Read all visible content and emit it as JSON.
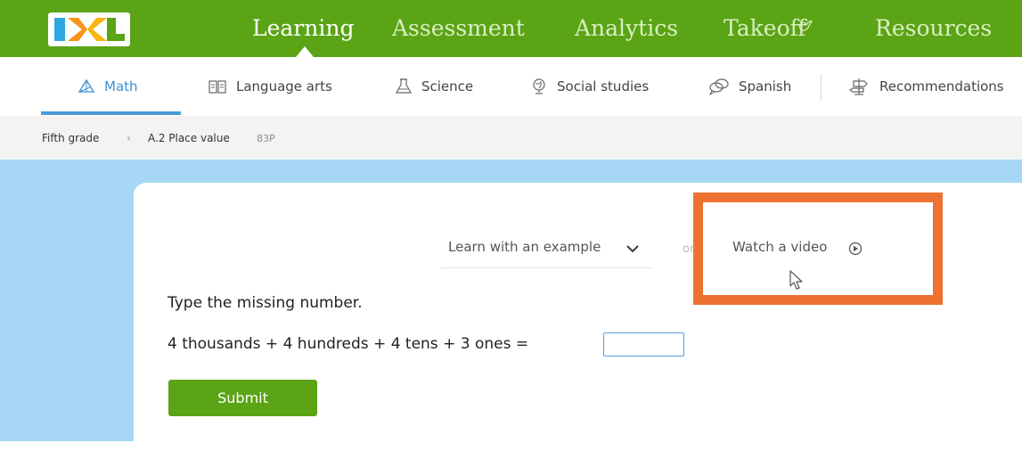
{
  "brand": {
    "logo_text": "IXL",
    "colors": {
      "brand_green": "#5aa415",
      "link_blue": "#3d8fd1",
      "practice_blue": "#a6d8f5",
      "highlight_orange": "#ed7130"
    }
  },
  "topnav": {
    "items": [
      {
        "label": "Learning",
        "active": true
      },
      {
        "label": "Assessment",
        "active": false
      },
      {
        "label": "Analytics",
        "active": false
      },
      {
        "label": "Takeoff",
        "active": false,
        "icon": "bird-icon"
      },
      {
        "label": "Resources",
        "active": false
      }
    ]
  },
  "subjects": {
    "tabs": [
      {
        "label": "Math",
        "icon": "geometry-icon",
        "active": true
      },
      {
        "label": "Language arts",
        "icon": "book-icon",
        "active": false
      },
      {
        "label": "Science",
        "icon": "flask-icon",
        "active": false
      },
      {
        "label": "Social studies",
        "icon": "globe-icon",
        "active": false
      },
      {
        "label": "Spanish",
        "icon": "speech-bubbles-icon",
        "active": false
      },
      {
        "label": "Recommendations",
        "icon": "signpost-icon",
        "active": false
      }
    ]
  },
  "breadcrumb": {
    "grade": "Fifth grade",
    "separator": "›",
    "skill": "A.2 Place value",
    "code": "83P"
  },
  "practice": {
    "learn_example_label": "Learn with an example",
    "or_label": "or",
    "watch_video_label": "Watch a video",
    "question": "Type the missing number.",
    "equation": "4 thousands + 4 hundreds + 4 tens + 3 ones =",
    "answer_value": "",
    "submit_label": "Submit"
  }
}
